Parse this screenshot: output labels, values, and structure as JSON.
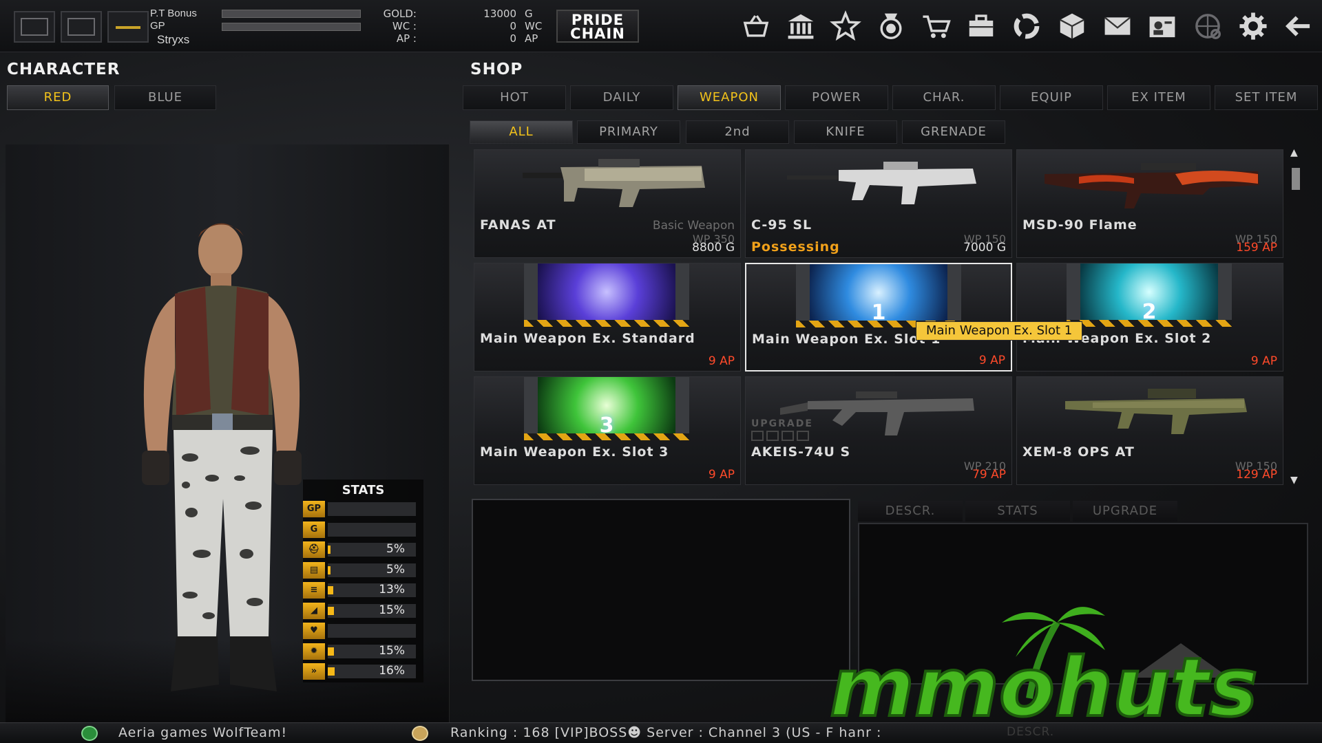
{
  "topbar": {
    "pt_bonus_label": "P.T Bonus",
    "gp_label": "GP",
    "username": "Stryxs",
    "gold_label": "GOLD:",
    "wc_label": "WC :",
    "ap_label": "AP :",
    "gold_value": "13000",
    "gold_unit": "G",
    "wc_value": "0",
    "wc_unit": "WC",
    "ap_value": "0",
    "ap_unit": "AP",
    "pride_line1": "PRIDE",
    "pride_line2": "CHAIN",
    "icons": [
      "basket-icon",
      "bank-icon",
      "star-icon",
      "medal-icon",
      "cart-icon",
      "briefcase-icon",
      "recycle-icon",
      "box-icon",
      "mail-icon",
      "profile-icon",
      "globe-icon",
      "gear-icon",
      "back-arrow-icon"
    ]
  },
  "character": {
    "title": "CHARACTER",
    "tabs": [
      {
        "label": "RED",
        "active": true
      },
      {
        "label": "BLUE",
        "active": false
      }
    ],
    "stats": {
      "title": "STATS",
      "rows": [
        {
          "icon": "GP",
          "value": "",
          "fill": 0
        },
        {
          "icon": "G",
          "value": "",
          "fill": 0
        },
        {
          "icon": "helmet-icon",
          "value": "5%",
          "fill": 5
        },
        {
          "icon": "armor-icon",
          "value": "5%",
          "fill": 5
        },
        {
          "icon": "ammo-icon",
          "value": "13%",
          "fill": 13
        },
        {
          "icon": "boot-icon",
          "value": "15%",
          "fill": 15
        },
        {
          "icon": "heart-icon",
          "value": "",
          "fill": 0
        },
        {
          "icon": "burst-icon",
          "value": "15%",
          "fill": 15
        },
        {
          "icon": "speed-icon",
          "value": "16%",
          "fill": 16
        }
      ]
    }
  },
  "shop": {
    "title": "SHOP",
    "tabs": [
      {
        "label": "HOT",
        "active": false
      },
      {
        "label": "DAILY",
        "active": false
      },
      {
        "label": "WEAPON",
        "active": true
      },
      {
        "label": "POWER",
        "active": false
      },
      {
        "label": "CHAR.",
        "active": false
      },
      {
        "label": "EQUIP",
        "active": false
      },
      {
        "label": "EX ITEM",
        "active": false
      },
      {
        "label": "SET ITEM",
        "active": false
      }
    ],
    "subtabs": [
      {
        "label": "ALL",
        "active": true
      },
      {
        "label": "PRIMARY",
        "active": false
      },
      {
        "label": "2nd",
        "active": false
      },
      {
        "label": "KNIFE",
        "active": false
      },
      {
        "label": "GRENADE",
        "active": false
      }
    ],
    "items": [
      {
        "name": "FANAS AT",
        "tag": "Basic Weapon",
        "wp": "WP 350",
        "price": "8800 G",
        "currency": "gold",
        "possessing": ""
      },
      {
        "name": "C-95 SL",
        "tag": "",
        "wp": "WP 150",
        "price": "7000 G",
        "currency": "gold",
        "possessing": "Possessing"
      },
      {
        "name": "MSD-90 Flame",
        "tag": "",
        "wp": "WP 150",
        "price": "159 AP",
        "currency": "ap",
        "possessing": ""
      },
      {
        "name": "Main Weapon Ex. Standard",
        "tag": "",
        "wp": "",
        "price": "9 AP",
        "currency": "ap",
        "possessing": ""
      },
      {
        "name": "Main Weapon Ex. Slot 1",
        "tag": "",
        "wp": "",
        "price": "9 AP",
        "currency": "ap",
        "possessing": ""
      },
      {
        "name": "Main Weapon Ex. Slot 2",
        "tag": "",
        "wp": "",
        "price": "9 AP",
        "currency": "ap",
        "possessing": ""
      },
      {
        "name": "Main Weapon Ex. Slot 3",
        "tag": "",
        "wp": "",
        "price": "9 AP",
        "currency": "ap",
        "possessing": ""
      },
      {
        "name": "AKEIS-74U S",
        "tag": "",
        "wp": "WP 210",
        "price": "79 AP",
        "currency": "ap",
        "possessing": "",
        "upgrade_label": "UPGRADE"
      },
      {
        "name": "XEM-8 OPS AT",
        "tag": "",
        "wp": "WP 150",
        "price": "129 AP",
        "currency": "ap",
        "possessing": ""
      }
    ],
    "tooltip": "Main Weapon Ex. Slot 1",
    "detail_tabs": [
      "DESCR.",
      "STATS",
      "UPGRADE"
    ]
  },
  "statusbar": {
    "welcome": "Aeria games WolfTeam!",
    "info": "Ranking : 168 [VIP]BOSS☻  Server : Channel 3 (US - F hanr :",
    "faded": "DESCR."
  },
  "watermark": {
    "brand": "mmohuts"
  },
  "colors": {
    "accent_gold": "#f3c31a",
    "ap_red": "#ff4a2a",
    "possessing_orange": "#f1a11a",
    "tooltip_yellow": "#f5c63a",
    "brand_green": "#3fae1e"
  }
}
